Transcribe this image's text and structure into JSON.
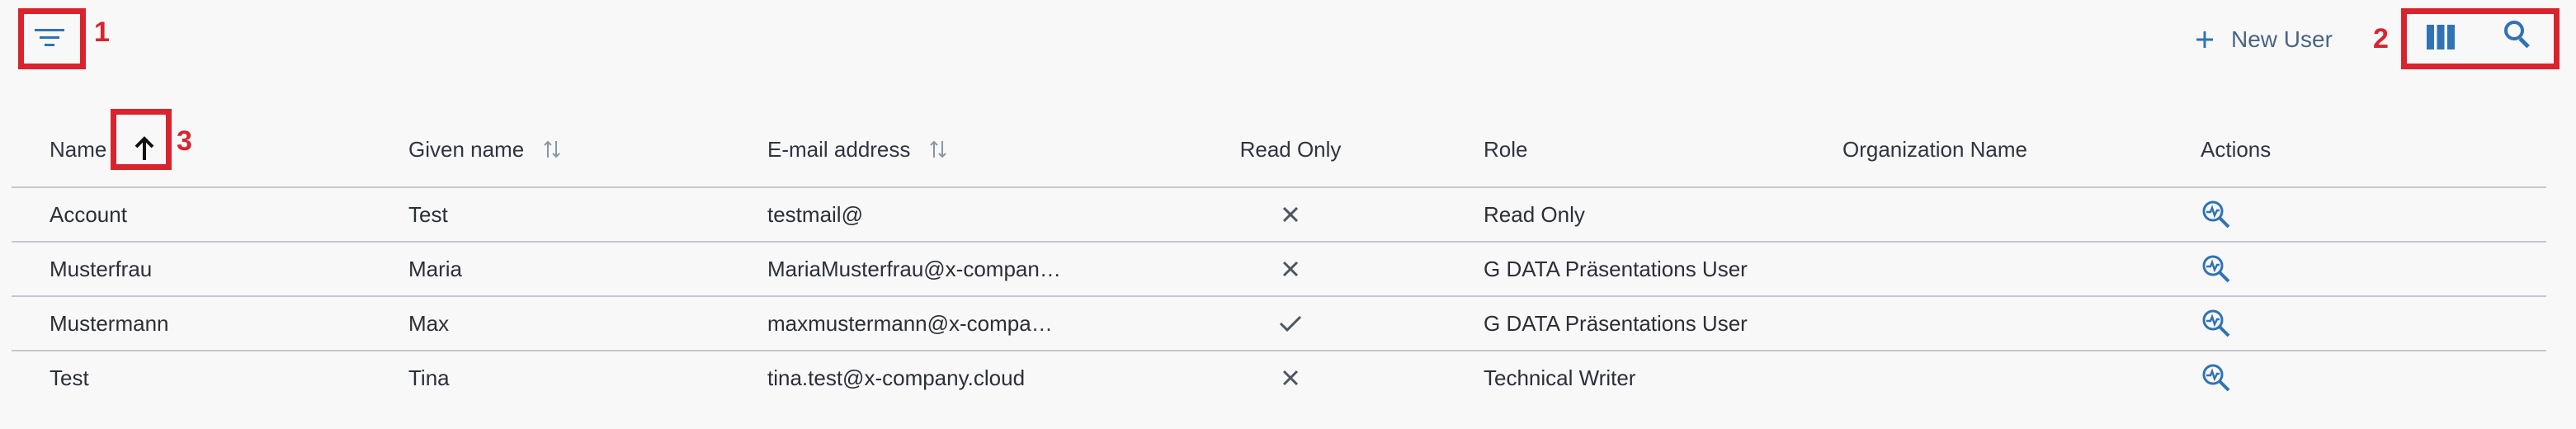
{
  "toolbar": {
    "new_user_label": "New User",
    "filter_icon": "filter-icon",
    "columns_icon": "columns-icon",
    "search_icon": "search-icon"
  },
  "callouts": {
    "one": "1",
    "two": "2",
    "three": "3"
  },
  "table": {
    "headers": [
      "Name",
      "Given name",
      "E-mail address",
      "Read Only",
      "Role",
      "Organization Name",
      "Actions"
    ],
    "rows": [
      {
        "name": "Account",
        "given_name": "Test",
        "email": "testmail@",
        "read_only": false,
        "role": "Read Only",
        "organization_name": ""
      },
      {
        "name": "Musterfrau",
        "given_name": "Maria",
        "email": "MariaMusterfrau@x-compan…",
        "read_only": false,
        "role": "G DATA Präsentations User",
        "organization_name": ""
      },
      {
        "name": "Mustermann",
        "given_name": "Max",
        "email": "maxmustermann@x-compa…",
        "read_only": true,
        "role": "G DATA Präsentations User",
        "organization_name": ""
      },
      {
        "name": "Test",
        "given_name": "Tina",
        "email": "tina.test@x-company.cloud",
        "read_only": false,
        "role": "Technical Writer",
        "organization_name": ""
      }
    ]
  },
  "colors": {
    "accent": "#2f73b5",
    "callout": "#d9242d",
    "text": "#2b2f36"
  }
}
